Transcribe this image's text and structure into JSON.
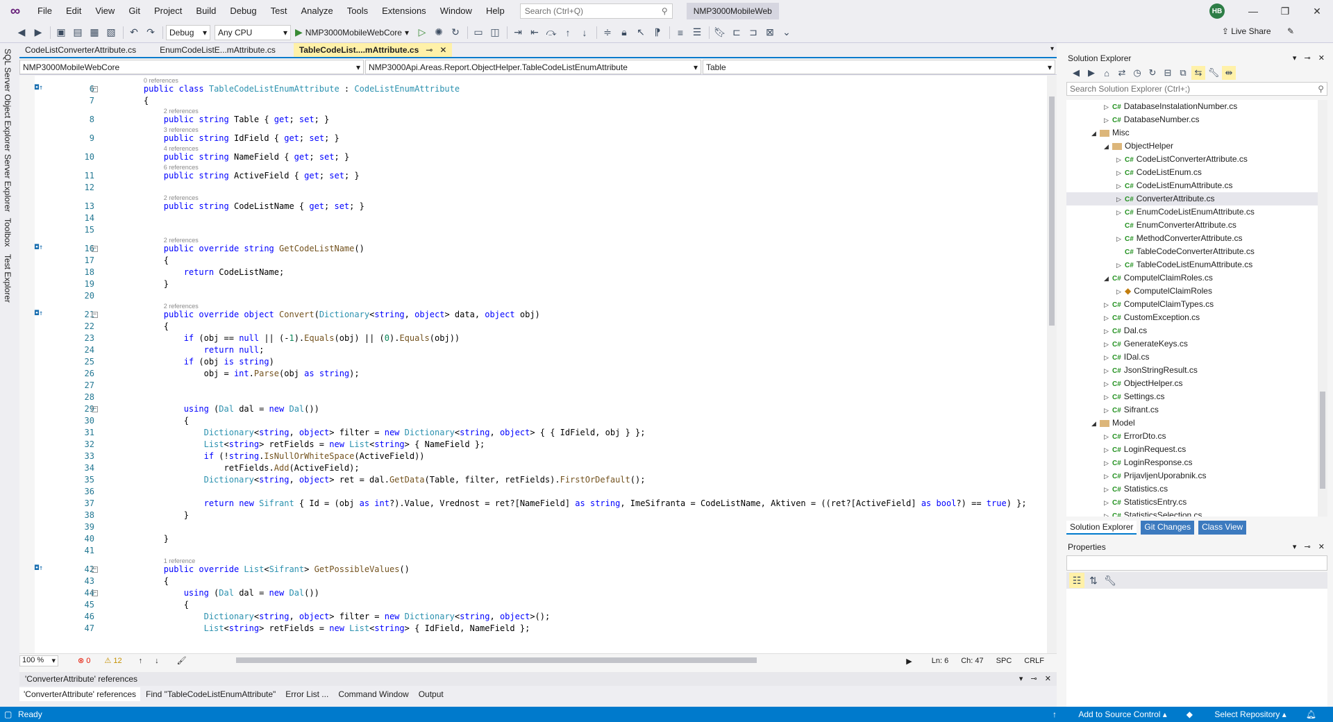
{
  "menu": {
    "items": [
      "File",
      "Edit",
      "View",
      "Git",
      "Project",
      "Build",
      "Debug",
      "Test",
      "Analyze",
      "Tools",
      "Extensions",
      "Window",
      "Help"
    ],
    "search_placeholder": "Search (Ctrl+Q)",
    "solution_name": "NMP3000MobileWeb",
    "user_initials": "HB"
  },
  "toolbar": {
    "config": "Debug",
    "platform": "Any CPU",
    "startup_project": "NMP3000MobileWebCore",
    "live_share": "Live Share"
  },
  "left_tabs": [
    "SQL Server Object Explorer",
    "Server Explorer",
    "Toolbox",
    "Test Explorer"
  ],
  "doc_tabs": [
    {
      "label": "CodeListConverterAttribute.cs",
      "active": false
    },
    {
      "label": "EnumCodeListE...mAttribute.cs",
      "active": false
    },
    {
      "label": "TableCodeList....mAttribute.cs",
      "active": true
    }
  ],
  "nav": {
    "project": "NMP3000MobileWebCore",
    "type": "NMP3000Api.Areas.Report.ObjectHelper.TableCodeListEnumAttribute",
    "member": "Table"
  },
  "code_lines": [
    {
      "n": "6",
      "ref": "0 references",
      "text": "    public class TableCodeListEnumAttribute : CodeListEnumAttribute",
      "bm": true,
      "fold": true
    },
    {
      "n": "7",
      "text": "    {"
    },
    {
      "n": "8",
      "ref": "2 references",
      "text": "        public string Table { get; set; }"
    },
    {
      "n": "9",
      "ref": "3 references",
      "text": "        public string IdField { get; set; }"
    },
    {
      "n": "10",
      "ref": "4 references",
      "text": "        public string NameField { get; set; }"
    },
    {
      "n": "11",
      "ref": "6 references",
      "text": "        public string ActiveField { get; set; }"
    },
    {
      "n": "12",
      "text": ""
    },
    {
      "n": "13",
      "ref": "2 references",
      "text": "        public string CodeListName { get; set; }"
    },
    {
      "n": "14",
      "text": ""
    },
    {
      "n": "15",
      "text": ""
    },
    {
      "n": "16",
      "ref": "2 references",
      "text": "        public override string GetCodeListName()",
      "bm": true,
      "fold": true
    },
    {
      "n": "17",
      "text": "        {"
    },
    {
      "n": "18",
      "text": "            return CodeListName;"
    },
    {
      "n": "19",
      "text": "        }"
    },
    {
      "n": "20",
      "text": ""
    },
    {
      "n": "21",
      "ref": "2 references",
      "text": "        public override object Convert(Dictionary<string, object> data, object obj)",
      "bm": true,
      "fold": true
    },
    {
      "n": "22",
      "text": "        {"
    },
    {
      "n": "23",
      "text": "            if (obj == null || (-1).Equals(obj) || (0).Equals(obj))"
    },
    {
      "n": "24",
      "text": "                return null;"
    },
    {
      "n": "25",
      "text": "            if (obj is string)"
    },
    {
      "n": "26",
      "text": "                obj = int.Parse(obj as string);"
    },
    {
      "n": "27",
      "text": ""
    },
    {
      "n": "28",
      "text": ""
    },
    {
      "n": "29",
      "text": "            using (Dal dal = new Dal())",
      "fold": true
    },
    {
      "n": "30",
      "text": "            {"
    },
    {
      "n": "31",
      "text": "                Dictionary<string, object> filter = new Dictionary<string, object> { { IdField, obj } };"
    },
    {
      "n": "32",
      "text": "                List<string> retFields = new List<string> { NameField };"
    },
    {
      "n": "33",
      "text": "                if (!string.IsNullOrWhiteSpace(ActiveField))"
    },
    {
      "n": "34",
      "text": "                    retFields.Add(ActiveField);"
    },
    {
      "n": "35",
      "text": "                Dictionary<string, object> ret = dal.GetData(Table, filter, retFields).FirstOrDefault();"
    },
    {
      "n": "36",
      "text": ""
    },
    {
      "n": "37",
      "text": "                return new Sifrant { Id = (obj as int?).Value, Vrednost = ret?[NameField] as string, ImeSifranta = CodeListName, Aktiven = ((ret?[ActiveField] as bool?) == true) };"
    },
    {
      "n": "38",
      "text": "            }"
    },
    {
      "n": "39",
      "text": ""
    },
    {
      "n": "40",
      "text": "        }"
    },
    {
      "n": "41",
      "text": ""
    },
    {
      "n": "42",
      "ref": "1 reference",
      "text": "        public override List<Sifrant> GetPossibleValues()",
      "bm": true,
      "fold": true
    },
    {
      "n": "43",
      "text": "        {"
    },
    {
      "n": "44",
      "text": "            using (Dal dal = new Dal())",
      "fold": true
    },
    {
      "n": "45",
      "text": "            {"
    },
    {
      "n": "46",
      "text": "                Dictionary<string, object> filter = new Dictionary<string, object>();"
    },
    {
      "n": "47",
      "text": "                List<string> retFields = new List<string> { IdField, NameField };"
    }
  ],
  "editor_status": {
    "zoom": "100 %",
    "errors": "0",
    "warnings": "12",
    "line": "Ln: 6",
    "col": "Ch: 47",
    "spc": "SPC",
    "crlf": "CRLF"
  },
  "bottom_panel": {
    "title": "'ConverterAttribute' references",
    "tabs": [
      "'ConverterAttribute' references",
      "Find \"TableCodeListEnumAttribute\"",
      "Error List ...",
      "Command Window",
      "Output"
    ]
  },
  "solution_explorer": {
    "title": "Solution Explorer",
    "search_placeholder": "Search Solution Explorer (Ctrl+;)",
    "items": [
      {
        "label": "DatabaseInstalationNumber.cs",
        "kind": "cs",
        "indent": 2,
        "exp": "collapsed"
      },
      {
        "label": "DatabaseNumber.cs",
        "kind": "cs",
        "indent": 2,
        "exp": "collapsed"
      },
      {
        "label": "Misc",
        "kind": "folder",
        "indent": 1,
        "exp": "expanded"
      },
      {
        "label": "ObjectHelper",
        "kind": "folder",
        "indent": 2,
        "exp": "expanded"
      },
      {
        "label": "CodeListConverterAttribute.cs",
        "kind": "cs",
        "indent": 3,
        "exp": "collapsed"
      },
      {
        "label": "CodeListEnum.cs",
        "kind": "cs",
        "indent": 3,
        "exp": "collapsed"
      },
      {
        "label": "CodeListEnumAttribute.cs",
        "kind": "cs",
        "indent": 3,
        "exp": "collapsed"
      },
      {
        "label": "ConverterAttribute.cs",
        "kind": "cs",
        "indent": 3,
        "exp": "collapsed",
        "selected": true
      },
      {
        "label": "EnumCodeListEnumAttribute.cs",
        "kind": "cs",
        "indent": 3,
        "exp": "collapsed"
      },
      {
        "label": "EnumConverterAttribute.cs",
        "kind": "cs",
        "indent": 3,
        "exp": "none"
      },
      {
        "label": "MethodConverterAttribute.cs",
        "kind": "cs",
        "indent": 3,
        "exp": "collapsed"
      },
      {
        "label": "TableCodeConverterAttribute.cs",
        "kind": "cs",
        "indent": 3,
        "exp": "none"
      },
      {
        "label": "TableCodeListEnumAttribute.cs",
        "kind": "cs",
        "indent": 3,
        "exp": "collapsed"
      },
      {
        "label": "ComputelClaimRoles.cs",
        "kind": "cs",
        "indent": 2,
        "exp": "expanded"
      },
      {
        "label": "ComputelClaimRoles",
        "kind": "class",
        "indent": 3,
        "exp": "collapsed"
      },
      {
        "label": "ComputelClaimTypes.cs",
        "kind": "cs",
        "indent": 2,
        "exp": "collapsed"
      },
      {
        "label": "CustomException.cs",
        "kind": "cs",
        "indent": 2,
        "exp": "collapsed"
      },
      {
        "label": "Dal.cs",
        "kind": "cs",
        "indent": 2,
        "exp": "collapsed"
      },
      {
        "label": "GenerateKeys.cs",
        "kind": "cs",
        "indent": 2,
        "exp": "collapsed"
      },
      {
        "label": "IDal.cs",
        "kind": "cs",
        "indent": 2,
        "exp": "collapsed"
      },
      {
        "label": "JsonStringResult.cs",
        "kind": "cs",
        "indent": 2,
        "exp": "collapsed"
      },
      {
        "label": "ObjectHelper.cs",
        "kind": "cs",
        "indent": 2,
        "exp": "collapsed"
      },
      {
        "label": "Settings.cs",
        "kind": "cs",
        "indent": 2,
        "exp": "collapsed"
      },
      {
        "label": "Sifrant.cs",
        "kind": "cs",
        "indent": 2,
        "exp": "collapsed"
      },
      {
        "label": "Model",
        "kind": "folder",
        "indent": 1,
        "exp": "expanded"
      },
      {
        "label": "ErrorDto.cs",
        "kind": "cs",
        "indent": 2,
        "exp": "collapsed"
      },
      {
        "label": "LoginRequest.cs",
        "kind": "cs",
        "indent": 2,
        "exp": "collapsed"
      },
      {
        "label": "LoginResponse.cs",
        "kind": "cs",
        "indent": 2,
        "exp": "collapsed"
      },
      {
        "label": "PrijavljenUporabnik.cs",
        "kind": "cs",
        "indent": 2,
        "exp": "collapsed"
      },
      {
        "label": "Statistics.cs",
        "kind": "cs",
        "indent": 2,
        "exp": "collapsed"
      },
      {
        "label": "StatisticsEntry.cs",
        "kind": "cs",
        "indent": 2,
        "exp": "collapsed"
      },
      {
        "label": "StatisticsSelection.cs",
        "kind": "cs",
        "indent": 2,
        "exp": "collapsed"
      }
    ],
    "tabs": [
      "Solution Explorer",
      "Git Changes",
      "Class View"
    ]
  },
  "properties": {
    "title": "Properties"
  },
  "status": {
    "ready": "Ready",
    "source_control": "Add to Source Control",
    "repository": "Select Repository"
  },
  "colors": {
    "accent": "#007acc",
    "keyword": "#0000ff",
    "type": "#2b91af",
    "method": "#74531f"
  }
}
